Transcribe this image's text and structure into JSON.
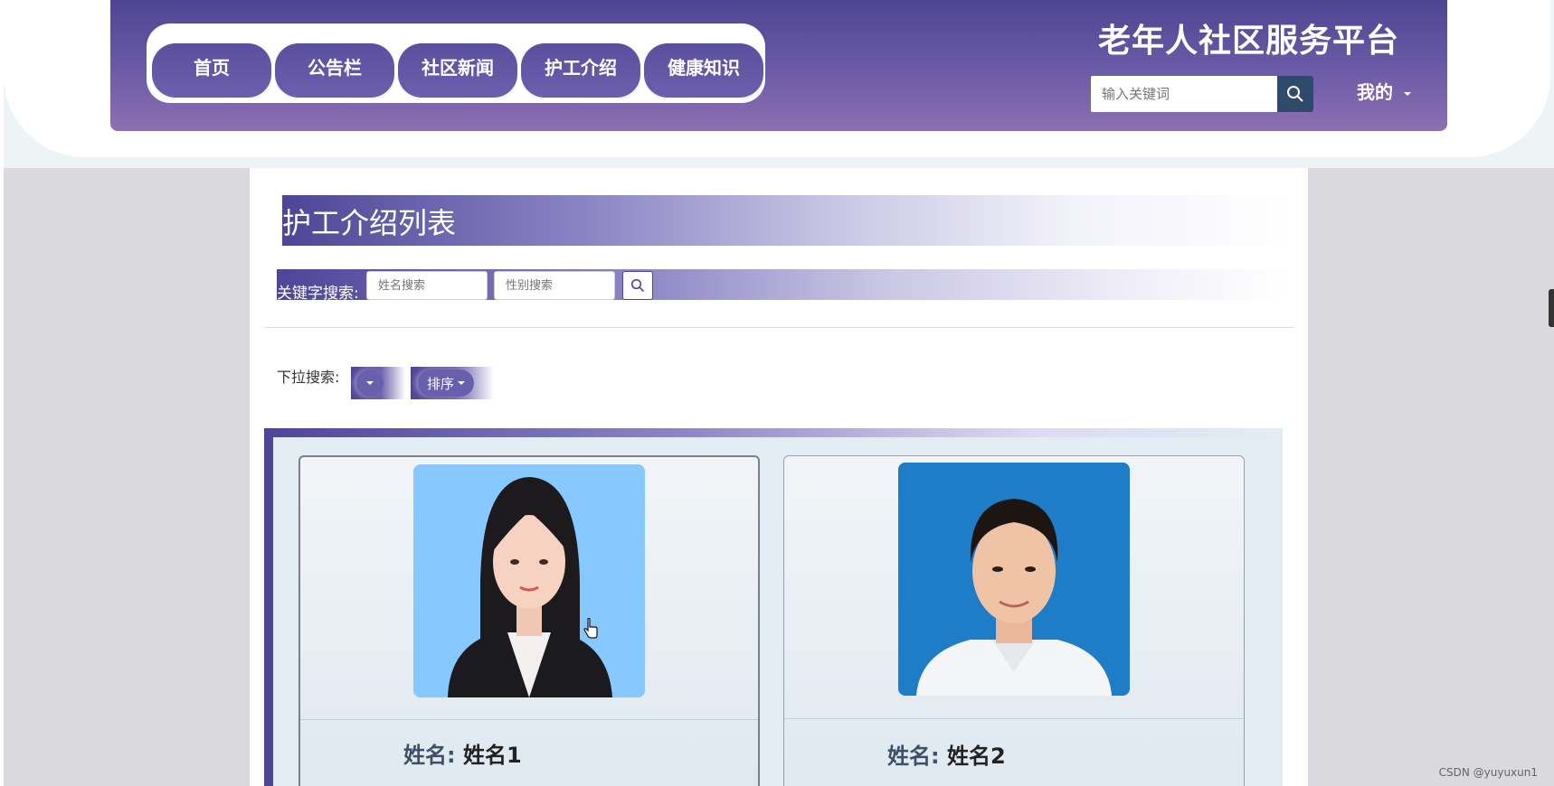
{
  "header": {
    "site_title": "老年人社区服务平台",
    "nav": [
      "首页",
      "公告栏",
      "社区新闻",
      "护工介绍",
      "健康知识"
    ],
    "search_placeholder": "输入关键词",
    "me_label": "我的"
  },
  "page": {
    "list_title": "护工介绍列表",
    "keyword_label": "关键字搜索:",
    "name_search_placeholder": "姓名搜索",
    "gender_search_placeholder": "性别搜索",
    "dropdown_label": "下拉搜索:",
    "sort_label": "排序"
  },
  "cards": [
    {
      "name_key": "姓名:",
      "name_value": "姓名1"
    },
    {
      "name_key": "姓名:",
      "name_value": "姓名2"
    }
  ],
  "watermark": "CSDN @yuyuxun1",
  "colors": {
    "brand_purple": "#4f4597",
    "header_gradient_end": "#8e6fb3",
    "search_button": "#2f4a6b"
  }
}
